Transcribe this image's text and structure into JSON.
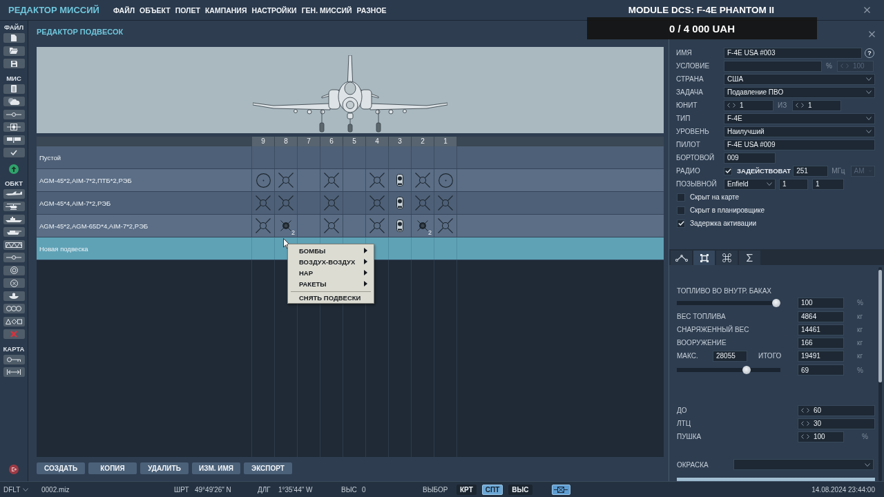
{
  "menubar": {
    "app_title": "РЕДАКТОР МИССИЙ",
    "menus": [
      "ФАЙЛ",
      "ОБЪЕКТ",
      "ПОЛЕТ",
      "КАМПАНИЯ",
      "НАСТРОЙКИ",
      "ГЕН. МИССИЙ",
      "РАЗНОЕ"
    ],
    "module_title": "MODULE DCS: F-4E PHANTOM II"
  },
  "donation_overlay": {
    "text": "0 / 4 000 UAH"
  },
  "toolbar": {
    "sections": [
      "ФАЙЛ",
      "МИС",
      "ОБКТ",
      "КАРТА"
    ]
  },
  "loadout_editor": {
    "title": "РЕДАКТОР ПОДВЕСОК",
    "stations": [
      "9",
      "8",
      "7",
      "6",
      "5",
      "4",
      "3",
      "2",
      "1"
    ],
    "loadouts": [
      {
        "name": "Пустой",
        "selected": false,
        "stations": [
          {
            "kind": "empty"
          },
          {
            "kind": "empty"
          },
          {
            "kind": "empty"
          },
          {
            "kind": "empty"
          },
          {
            "kind": "empty"
          },
          {
            "kind": "empty"
          },
          {
            "kind": "empty"
          },
          {
            "kind": "empty"
          },
          {
            "kind": "empty"
          }
        ]
      },
      {
        "name": "AGM-45*2,AIM-7*2,ПТБ*2,РЭБ",
        "selected": false,
        "stations": [
          {
            "kind": "tank"
          },
          {
            "kind": "missile"
          },
          {
            "kind": "empty"
          },
          {
            "kind": "missile"
          },
          {
            "kind": "empty"
          },
          {
            "kind": "missile"
          },
          {
            "kind": "pod"
          },
          {
            "kind": "missile"
          },
          {
            "kind": "tank"
          }
        ]
      },
      {
        "name": "AGM-45*4,AIM-7*2,РЭБ",
        "selected": false,
        "stations": [
          {
            "kind": "missile"
          },
          {
            "kind": "missile"
          },
          {
            "kind": "empty"
          },
          {
            "kind": "missile"
          },
          {
            "kind": "empty"
          },
          {
            "kind": "missile"
          },
          {
            "kind": "pod"
          },
          {
            "kind": "missile"
          },
          {
            "kind": "missile"
          }
        ]
      },
      {
        "name": "AGM-45*2,AGM-65D*4,AIM-7*2,РЭБ",
        "selected": false,
        "stations": [
          {
            "kind": "missile"
          },
          {
            "kind": "launcher",
            "count": "2"
          },
          {
            "kind": "empty"
          },
          {
            "kind": "missile"
          },
          {
            "kind": "empty"
          },
          {
            "kind": "missile"
          },
          {
            "kind": "pod"
          },
          {
            "kind": "launcher",
            "count": "2"
          },
          {
            "kind": "missile"
          }
        ]
      },
      {
        "name": "Новая подвеска",
        "selected": true,
        "stations": [
          {
            "kind": "empty"
          },
          {
            "kind": "empty"
          },
          {
            "kind": "empty"
          },
          {
            "kind": "empty"
          },
          {
            "kind": "empty"
          },
          {
            "kind": "empty"
          },
          {
            "kind": "empty"
          },
          {
            "kind": "empty"
          },
          {
            "kind": "empty"
          }
        ]
      }
    ],
    "context_menu": [
      {
        "kind": "submenu",
        "label": "БОМБЫ"
      },
      {
        "kind": "submenu",
        "label": "ВОЗДУХ-ВОЗДУХ"
      },
      {
        "kind": "submenu",
        "label": "НАР"
      },
      {
        "kind": "submenu",
        "label": "РАКЕТЫ"
      },
      {
        "kind": "separator"
      },
      {
        "kind": "action",
        "label": "СНЯТЬ ПОДВЕСКИ"
      }
    ],
    "buttons": [
      "СОЗДАТЬ",
      "КОПИЯ",
      "УДАЛИТЬ",
      "ИЗМ. ИМЯ",
      "ЭКСПОРТ"
    ]
  },
  "group": {
    "name": {
      "label": "ИМЯ",
      "value": "F-4E USA #003",
      "help": "?"
    },
    "condition": {
      "label": "УСЛОВИЕ",
      "unit": "%",
      "chance": "100",
      "disabled": true
    },
    "country": {
      "label": "СТРАНА",
      "value": "США"
    },
    "task": {
      "label": "ЗАДАЧА",
      "value": "Подавление ПВО"
    },
    "unit": {
      "label": "ЮНИТ",
      "value": "1",
      "of_label": "ИЗ",
      "total": "1"
    },
    "type": {
      "label": "ТИП",
      "value": "F-4E"
    },
    "skill": {
      "label": "УРОВЕНЬ",
      "value": "Наилучший"
    },
    "pilot": {
      "label": "ПИЛОТ",
      "value": "F-4E USA #009"
    },
    "tail_number": {
      "label": "БОРТОВОЙ",
      "value": "009"
    },
    "radio": {
      "label": "РАДИО",
      "checked": true,
      "checkbox_label": "ЗАДЕЙСТВОВАТ",
      "frequency": "251",
      "unit": "МГц",
      "modulation": "AM",
      "modulation_disabled": true
    },
    "callsign": {
      "label": "ПОЗЫВНОЙ",
      "value": "Enfield",
      "number_1": "1",
      "number_2": "1"
    },
    "flags": [
      {
        "label": "Скрыт на карте",
        "checked": false
      },
      {
        "label": "Скрыт в планировщике",
        "checked": false
      },
      {
        "label": "Задержка активации",
        "checked": true
      }
    ]
  },
  "group_tabs": [
    {
      "selected": false
    },
    {
      "selected": true
    },
    {
      "selected": false
    },
    {
      "selected": false
    }
  ],
  "payload": {
    "internal_fuel": {
      "label": "ТОПЛИВО ВО ВНУТР. БАКАХ",
      "level": 1,
      "value": "100",
      "unit": "%"
    },
    "weights": [
      {
        "label": "ВЕС ТОПЛИВА",
        "value": "4864",
        "unit": "кг"
      },
      {
        "label": "СНАРЯЖЕННЫЙ ВЕС",
        "value": "14461",
        "unit": "кг"
      },
      {
        "label": "ВООРУЖЕНИЕ",
        "value": "166",
        "unit": "кг"
      }
    ],
    "max": {
      "label": "МАКС.",
      "value": "28055"
    },
    "total": {
      "label": "ИТОГО",
      "value": "19491",
      "unit": "кг"
    },
    "load": {
      "level": 0.69,
      "value": "69",
      "unit": "%"
    },
    "countermeasures": [
      {
        "label": "ДО",
        "value": "60"
      },
      {
        "label": "ЛТЦ",
        "value": "30"
      }
    ],
    "gun": {
      "label": "ПУШКА",
      "value": "100",
      "unit": "%"
    },
    "livery": {
      "label": "ОКРАСКА"
    }
  },
  "status_bar": {
    "profile": "DFLT",
    "file": "0002.miz",
    "coords": [
      {
        "label": "ШРТ",
        "value": "49°49'26\" N"
      },
      {
        "label": "ДЛГ",
        "value": "1°35'44\" W"
      },
      {
        "label": "ВЫС",
        "value": "0"
      }
    ],
    "mode_label": "ВЫБОР",
    "modes": [
      {
        "label": "КРТ",
        "selected": false
      },
      {
        "label": "СПТ",
        "selected": true
      },
      {
        "label": "ВЫС",
        "selected": false
      }
    ],
    "overlay_toggle": {
      "on": true
    },
    "datetime": "14.08.2024 23:44:00"
  }
}
